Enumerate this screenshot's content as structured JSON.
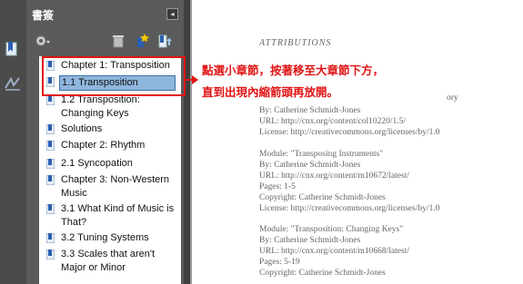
{
  "bookmarks_panel": {
    "title": "書簽",
    "collapse_glyph": "◂",
    "toolbar_icons": [
      "gear-icon",
      "delete-icon",
      "new-bookmark-icon",
      "expand-bookmark-icon"
    ],
    "items": [
      {
        "label": "Chapter 1: Transposition"
      },
      {
        "label": "1.1 Transposition",
        "selected": true
      },
      {
        "label": "1.2 Transposition: Changing Keys"
      },
      {
        "label": "Solutions"
      },
      {
        "label": "Chapter 2: Rhythm"
      },
      {
        "label": "2.1 Syncopation"
      },
      {
        "label": "Chapter 3: Non-Western Music"
      },
      {
        "label": "3.1 What Kind of Music is That?"
      },
      {
        "label": "3.2 Tuning Systems"
      },
      {
        "label": "3.3 Scales that aren't Major or Minor"
      }
    ]
  },
  "annotation": {
    "line1": "點選小章節，按著移至大章節下方，",
    "line2": "直到出現內縮箭頭再放開。",
    "color": "#e21313"
  },
  "document": {
    "heading": "ATTRIBUTIONS",
    "fragment": "ory",
    "lines": [
      "By: Catherine Schmidt-Jones",
      "URL: http://cnx.org/content/col10220/1.5/",
      "License: http://creativecommons.org/licenses/by/1.0",
      "Module: \"Transposing Instruments\"",
      "By: Catherine Schmidt-Jones",
      "URL: http://cnx.org/content/m10672/latest/",
      "Pages: 1-5",
      "Copyright: Catherine Schmidt-Jones",
      "License: http://creativecommons.org/licenses/by/1.0",
      "Module: \"Transposition: Changing Keys\"",
      "By: Catherine Schmidt-Jones",
      "URL: http://cnx.org/content/m10668/latest/",
      "Pages: 5-19",
      "Copyright: Catherine Schmidt-Jones"
    ]
  }
}
